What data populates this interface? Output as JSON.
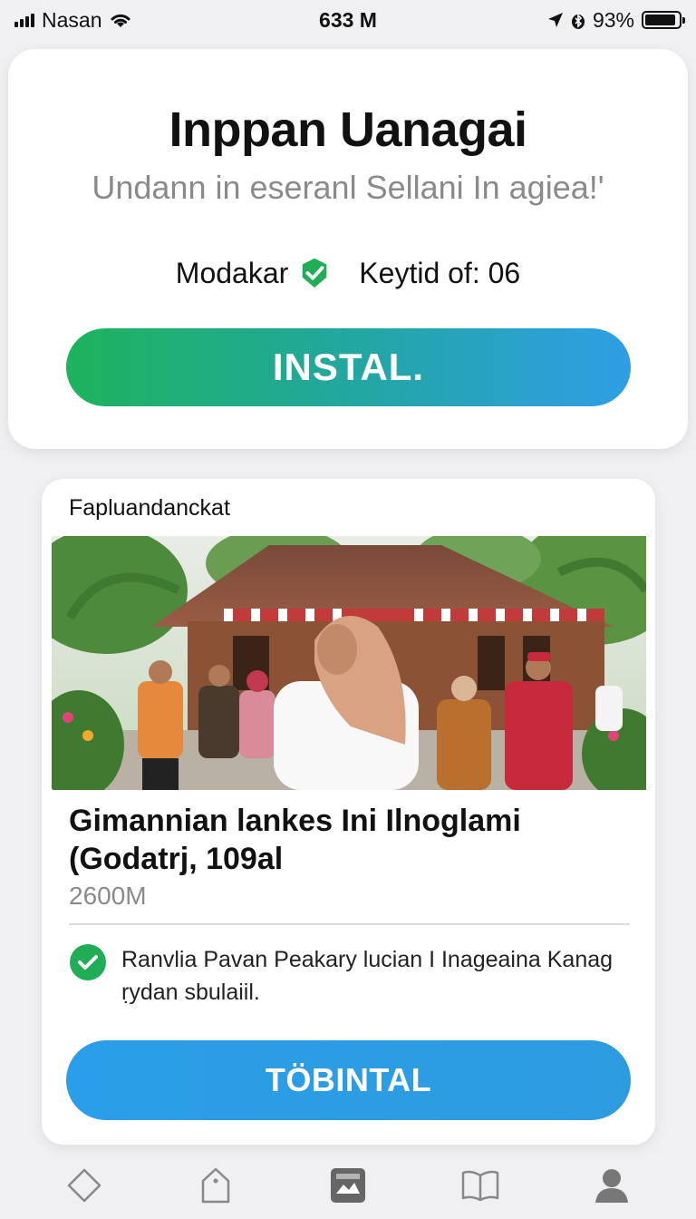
{
  "status_bar": {
    "carrier": "Nasan",
    "time": "633 M",
    "battery": "93%",
    "battery_level": 0.93
  },
  "top_card": {
    "title": "Inppan Uanagai",
    "subtitle": "Undann in eseranl Sellani In agiea!'",
    "meta_left": "Modakar",
    "meta_right": "Keytid of: 06",
    "install_label": "INSTAL."
  },
  "main_card": {
    "section_label": "Fapluandanckat",
    "event_title_line1": "Gimannian lankes Ini  Ilnoglami",
    "event_title_line2": "(Godatrj, 109al",
    "event_meta": "2600M",
    "feature_text_line1": "Ranvlia Pavan Peakary lucian I Inageaina Kanag",
    "feature_text_line2": "ṛydan sbulaiil.",
    "button_label": "TÖBINTAL"
  },
  "bottom_nav": {
    "items": [
      {
        "icon": "diamond-icon"
      },
      {
        "icon": "home-icon"
      },
      {
        "icon": "image-icon"
      },
      {
        "icon": "book-icon"
      },
      {
        "icon": "profile-icon"
      }
    ]
  },
  "colors": {
    "green": "#1db35c",
    "blue": "#2f9ee6",
    "gray_text": "#8a8a8a"
  }
}
